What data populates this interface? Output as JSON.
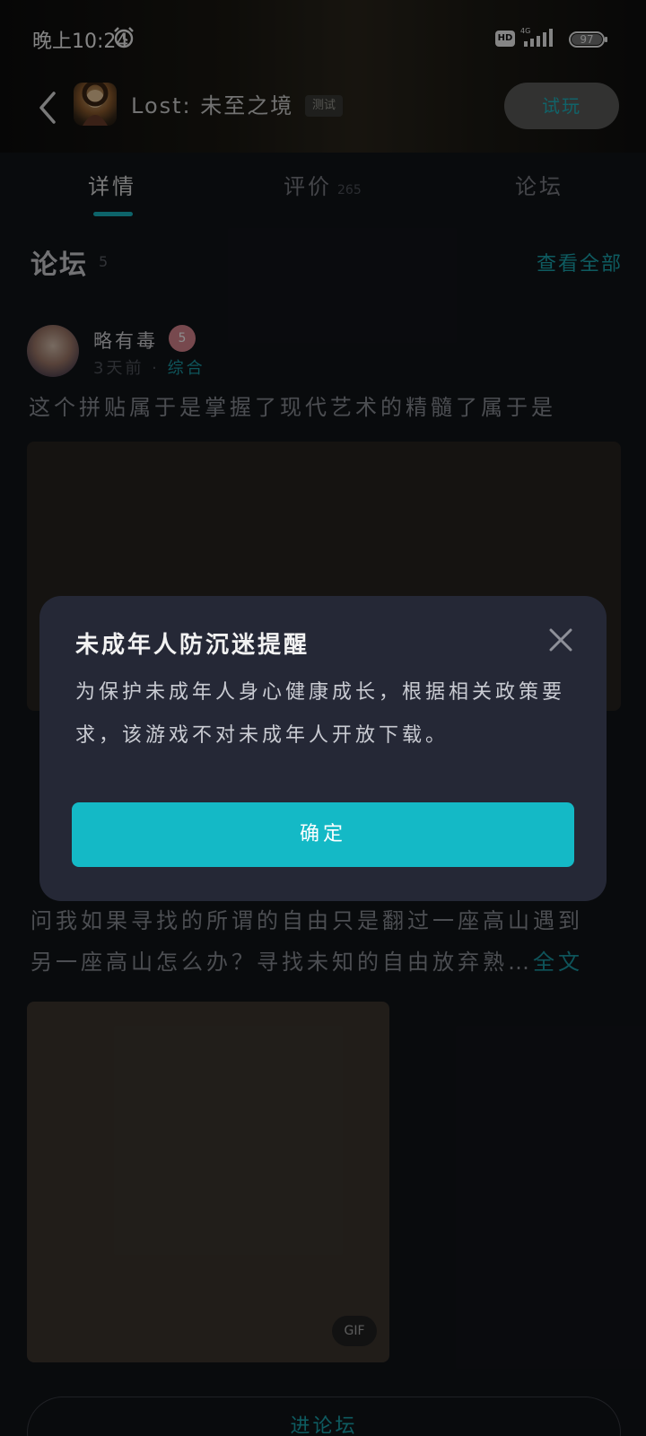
{
  "status_bar": {
    "time": "晚上10:24",
    "network": "HD",
    "signal_label": "4G",
    "battery": "97"
  },
  "header": {
    "game_title": "Lost: 未至之境",
    "test_badge": "测试",
    "trial_label": "试玩"
  },
  "tabs": [
    {
      "label": "详情",
      "count": ""
    },
    {
      "label": "评价",
      "count": "265"
    },
    {
      "label": "论坛",
      "count": ""
    }
  ],
  "forum": {
    "title": "论坛",
    "count": "5",
    "view_all": "查看全部",
    "post1": {
      "username": "略有毒",
      "level": "5",
      "meta_time": "3天前 · ",
      "meta_tag": "综合",
      "text": "这个拼贴属于是掌握了现代艺术的精髓了属于是"
    },
    "post2": {
      "line1": "问我如果寻找的所谓的自由只是翻过一座高山遇到",
      "line2": "另一座高山怎么办？寻找未知的自由放弃熟",
      "ellipsis": "…",
      "fulltext": "全文",
      "gif": "GIF"
    },
    "enter_label": "进论坛"
  },
  "modal": {
    "title": "未成年人防沉迷提醒",
    "body": "为保护未成年人身心健康成长，根据相关政策要求，该游戏不对未成年人开放下载。",
    "confirm": "确定"
  },
  "colors": {
    "accent": "#14b9c6",
    "background": "#121419",
    "modal_bg": "#252836"
  }
}
